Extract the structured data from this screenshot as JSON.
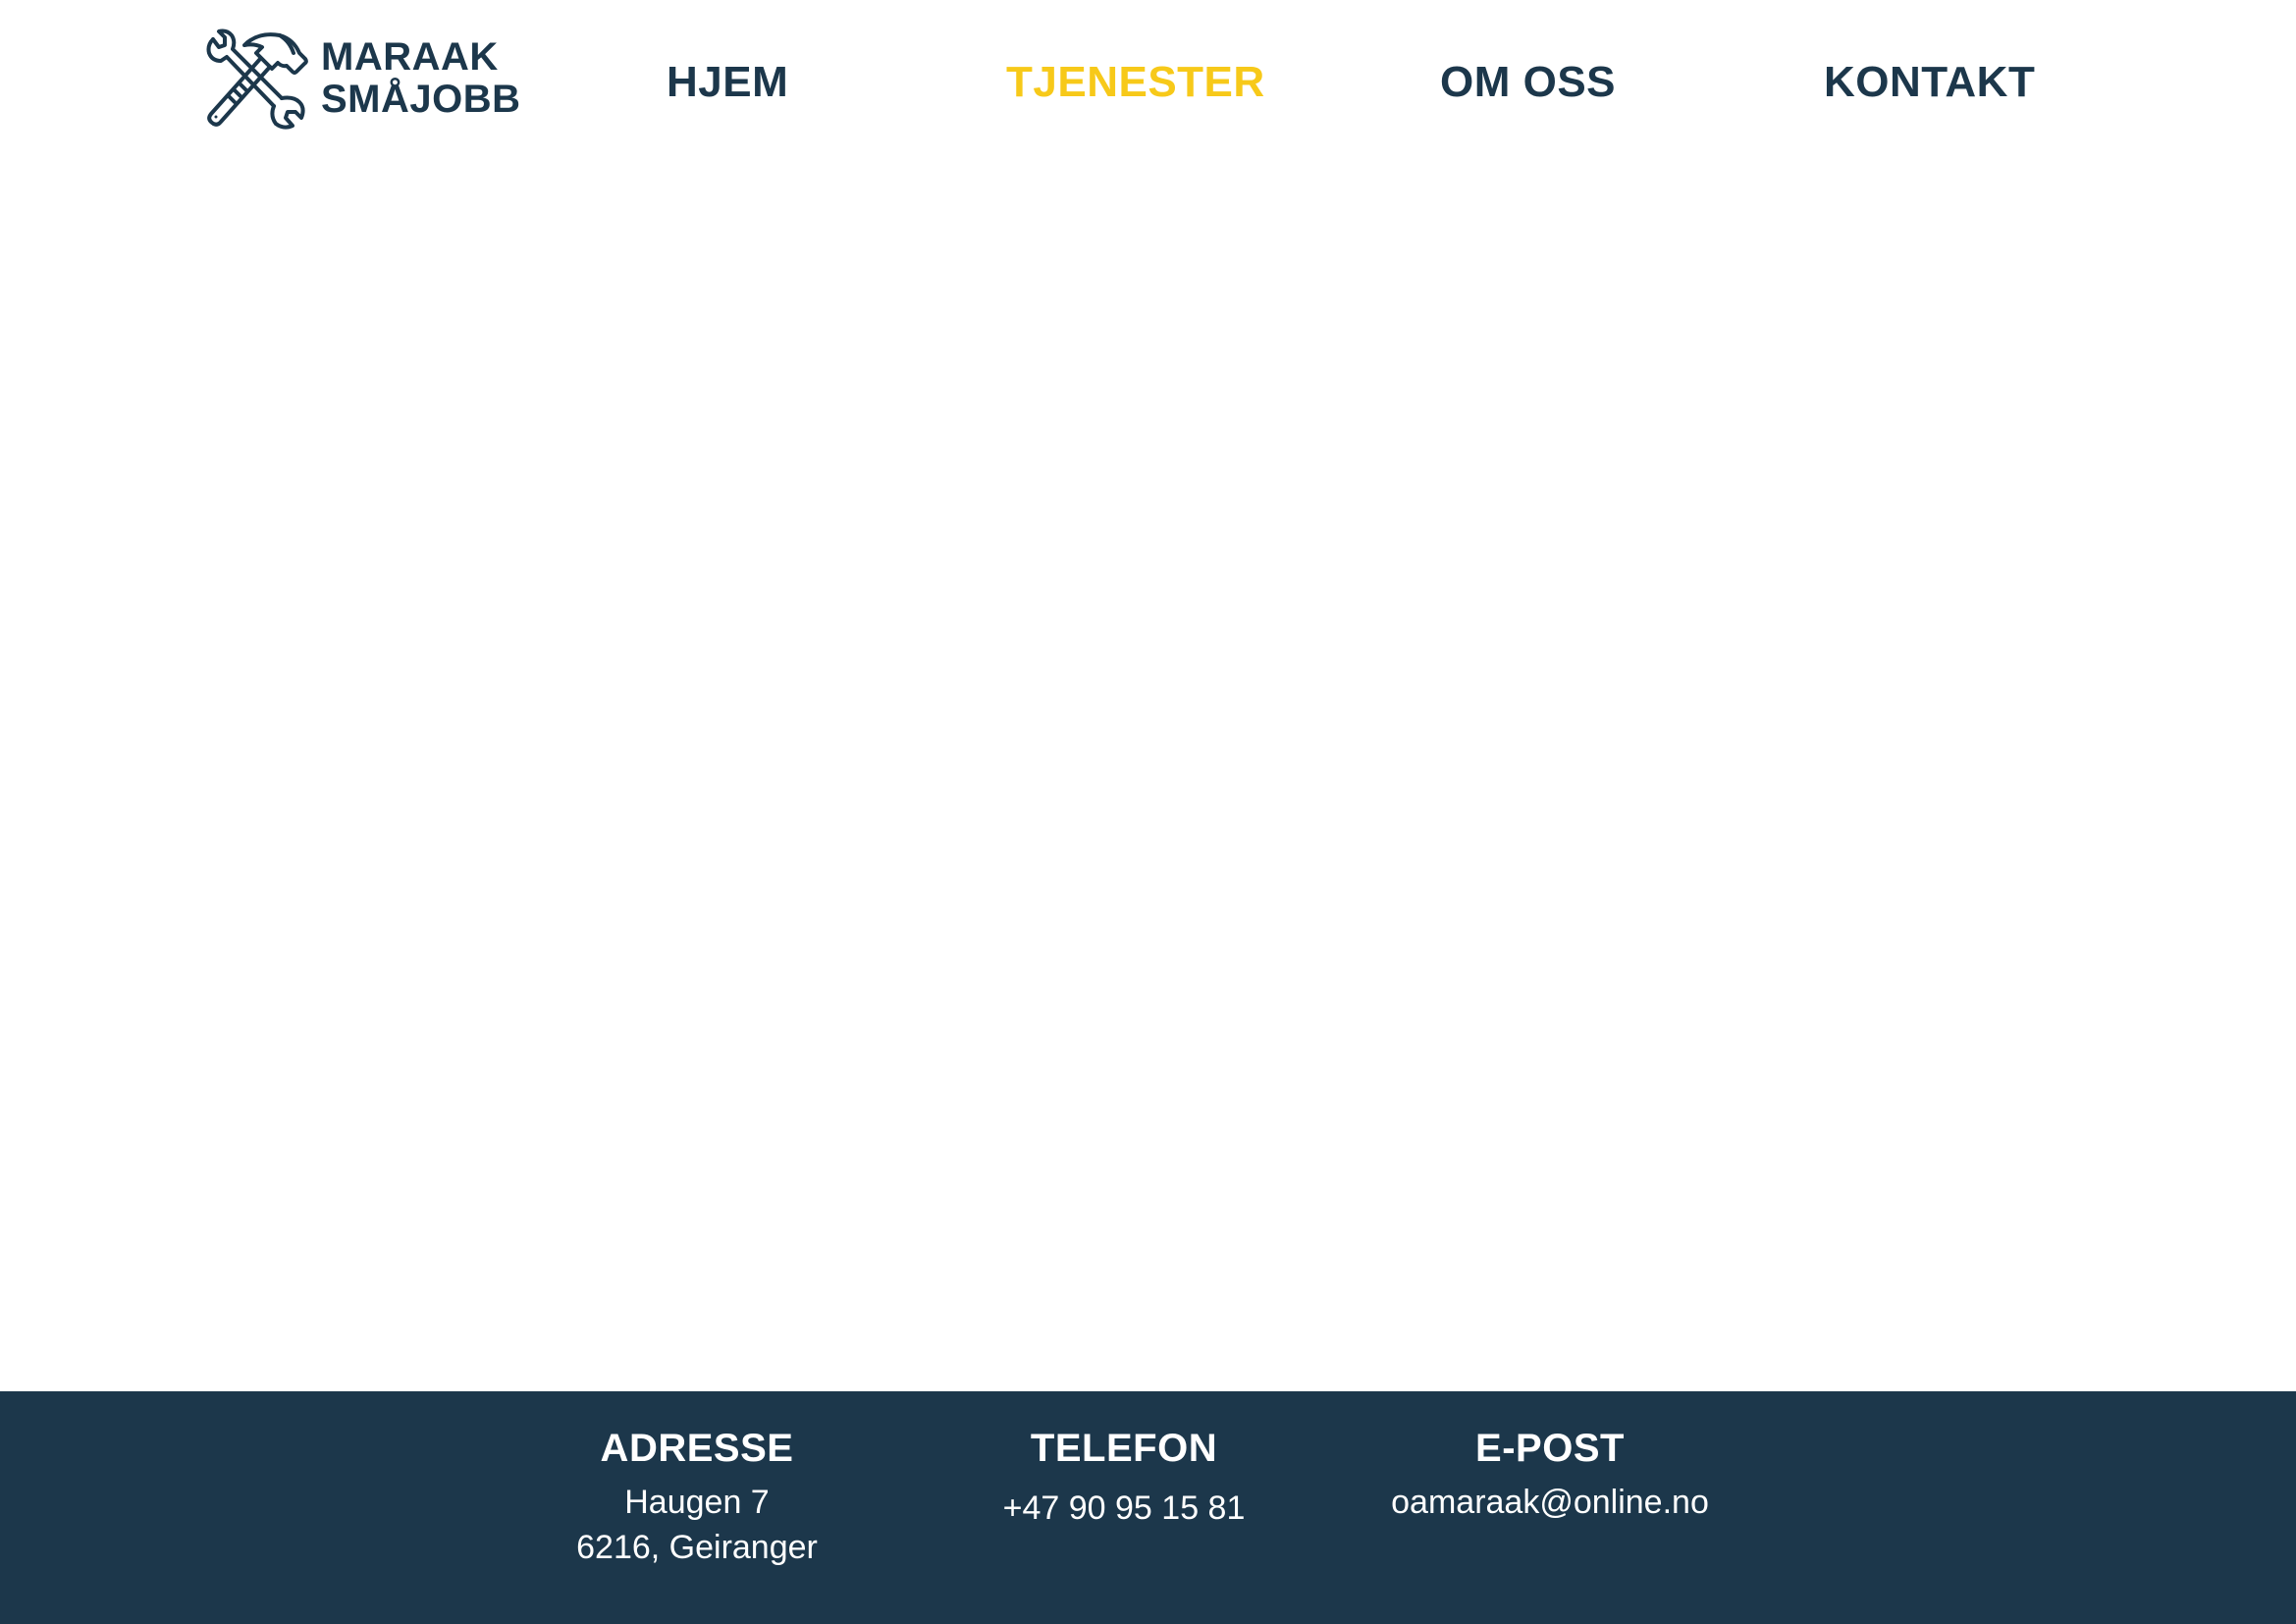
{
  "header": {
    "logo": {
      "icon": "hammer-wrench-icon",
      "line1": "MARAAK",
      "line2": "SMÅJOBB"
    },
    "nav": [
      {
        "label": "HJEM",
        "active": false
      },
      {
        "label": "TJENESTER",
        "active": true
      },
      {
        "label": "OM OSS",
        "active": false
      },
      {
        "label": "KONTAKT",
        "active": false
      }
    ]
  },
  "footer": {
    "address": {
      "heading": "ADRESSE",
      "line1": "Haugen 7",
      "line2": "6216, Geiranger"
    },
    "phone": {
      "heading": "TELEFON",
      "value": "+47 90 95 15 81"
    },
    "email": {
      "heading": "E-POST",
      "value": "oamaraak@online.no"
    }
  },
  "colors": {
    "primary": "#1c374b",
    "accent": "#f7c919",
    "background": "#ffffff",
    "footer_text": "#ffffff"
  }
}
